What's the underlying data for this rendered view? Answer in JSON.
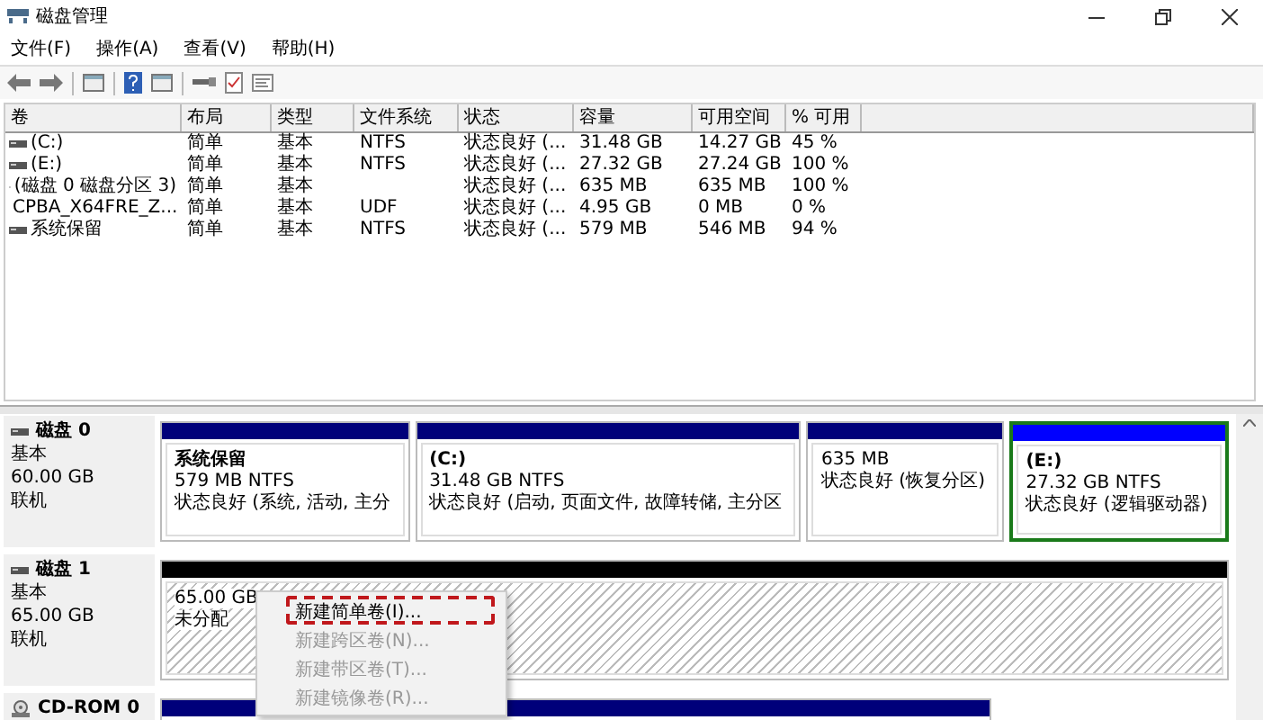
{
  "window": {
    "title": "磁盘管理"
  },
  "menu": [
    "文件(F)",
    "操作(A)",
    "查看(V)",
    "帮助(H)"
  ],
  "table": {
    "columns": [
      "卷",
      "布局",
      "类型",
      "文件系统",
      "状态",
      "容量",
      "可用空间",
      "% 可用"
    ],
    "rows": [
      {
        "kind": "disk",
        "cells": [
          "(C:)",
          "简单",
          "基本",
          "NTFS",
          "状态良好 (...",
          "31.48 GB",
          "14.27 GB",
          "45 %"
        ]
      },
      {
        "kind": "disk",
        "cells": [
          "(E:)",
          "简单",
          "基本",
          "NTFS",
          "状态良好 (...",
          "27.32 GB",
          "27.24 GB",
          "100 %"
        ]
      },
      {
        "kind": "disk",
        "cells": [
          "(磁盘 0 磁盘分区 3)",
          "简单",
          "基本",
          "",
          "状态良好 (...",
          "635 MB",
          "635 MB",
          "100 %"
        ]
      },
      {
        "kind": "cdrom",
        "cells": [
          "CPBA_X64FRE_Z...",
          "简单",
          "基本",
          "UDF",
          "状态良好 (...",
          "4.95 GB",
          "0 MB",
          "0 %"
        ]
      },
      {
        "kind": "disk",
        "cells": [
          "系统保留",
          "简单",
          "基本",
          "NTFS",
          "状态良好 (...",
          "579 MB",
          "546 MB",
          "94 %"
        ]
      }
    ]
  },
  "disks": [
    {
      "kind": "disk",
      "name": "磁盘 0",
      "type": "基本",
      "size": "60.00 GB",
      "status": "联机",
      "partitions": [
        {
          "kind": "primary",
          "selected": false,
          "title": "系统保留",
          "lines": [
            "579 MB NTFS",
            "状态良好 (系统, 活动, 主分"
          ]
        },
        {
          "kind": "primary",
          "selected": false,
          "title": "(C:)",
          "lines": [
            "31.48 GB NTFS",
            "状态良好 (启动, 页面文件, 故障转储, 主分区"
          ]
        },
        {
          "kind": "primary",
          "selected": false,
          "lines": [
            "635 MB",
            "状态良好 (恢复分区)"
          ]
        },
        {
          "kind": "logical",
          "selected": true,
          "title": "(E:)",
          "lines": [
            "27.32 GB NTFS",
            "状态良好 (逻辑驱动器)"
          ]
        }
      ]
    },
    {
      "kind": "disk",
      "name": "磁盘 1",
      "type": "基本",
      "size": "65.00 GB",
      "status": "联机",
      "partitions": [
        {
          "kind": "unallocated",
          "selected": false,
          "lines": [
            "65.00 GB",
            "未分配"
          ]
        }
      ]
    },
    {
      "kind": "cdrom",
      "name": "CD-ROM 0",
      "partitions": [
        {
          "kind": "primary",
          "selected": false
        }
      ]
    }
  ],
  "context_menu": [
    {
      "label": "新建简单卷(I)...",
      "disabled": false,
      "selected": true
    },
    {
      "label": "新建跨区卷(N)...",
      "disabled": true,
      "selected": false
    },
    {
      "label": "新建带区卷(T)...",
      "disabled": true,
      "selected": false
    },
    {
      "label": "新建镜像卷(R)...",
      "disabled": true,
      "selected": false
    }
  ]
}
